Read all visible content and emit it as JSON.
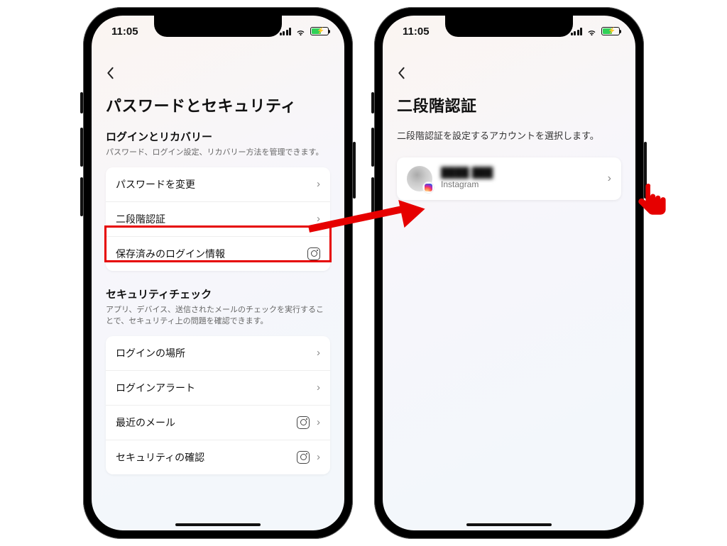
{
  "status": {
    "time": "11:05"
  },
  "screen1": {
    "title": "パスワードとセキュリティ",
    "section1": {
      "title": "ログインとリカバリー",
      "desc": "パスワード、ログイン設定、リカバリー方法を管理できます。",
      "rows": {
        "change_password": "パスワードを変更",
        "two_factor": "二段階認証",
        "saved_login": "保存済みのログイン情報"
      }
    },
    "section2": {
      "title": "セキュリティチェック",
      "desc": "アプリ、デバイス、送信されたメールのチェックを実行することで、セキュリティ上の問題を確認できます。",
      "rows": {
        "login_location": "ログインの場所",
        "login_alert": "ログインアラート",
        "recent_mail": "最近のメール",
        "security_check": "セキュリティの確認"
      }
    }
  },
  "screen2": {
    "title": "二段階認証",
    "desc": "二段階認証を設定するアカウントを選択します。",
    "account": {
      "name": "████ ███",
      "service": "Instagram"
    }
  }
}
